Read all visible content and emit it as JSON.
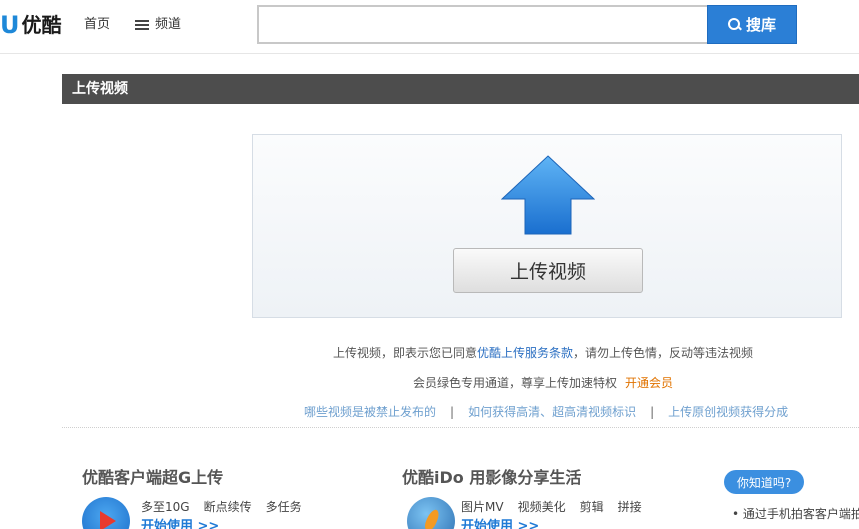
{
  "header": {
    "logo_u": "U",
    "logo_text": "优酷",
    "nav_home": "首页",
    "nav_channel": "频道",
    "search_placeholder": "",
    "search_button": "搜库"
  },
  "section": {
    "title": "上传视频"
  },
  "upload": {
    "button_label": "上传视频",
    "arrow_color": "#2f8be0"
  },
  "terms": {
    "prefix": "上传视频，即表示您已同意",
    "link": "优酷上传服务条款",
    "suffix": "，请勿上传色情，反动等违法视频"
  },
  "vip": {
    "text": "会员绿色专用通道，尊享上传加速特权",
    "link": "开通会员"
  },
  "help_links": {
    "link1": "哪些视频是被禁止发布的",
    "link2": "如何获得高清、超高清视频标识",
    "link3": "上传原创视频获得分成",
    "separator": "|"
  },
  "promo_client": {
    "title": "优酷客户端超G上传",
    "features": [
      "多至10G",
      "断点续传",
      "多任务"
    ],
    "start": "开始使用 >>"
  },
  "promo_ido": {
    "title": "优酷iDo 用影像分享生活",
    "features": [
      "图片MV",
      "视频美化",
      "剪辑",
      "拼接"
    ],
    "start": "开始使用 >>"
  },
  "sidebar": {
    "button_label": "你知道吗?",
    "bullet_text": "• 通过手机拍客客户端拍"
  },
  "colors": {
    "accent": "#2b7fd6",
    "section_bar": "#4d4d4d",
    "vip_orange": "#e07300"
  }
}
